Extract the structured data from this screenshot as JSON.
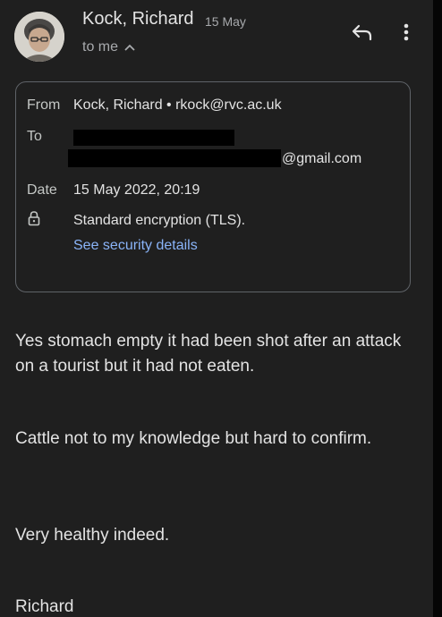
{
  "header": {
    "sender_name": "Kock, Richard",
    "date": "15 May",
    "recipient_summary": "to me"
  },
  "details": {
    "from_label": "From",
    "from_value": "Kock, Richard • rkock@rvc.ac.uk",
    "to_label": "To",
    "to_value_visible": "@gmail.com",
    "date_label": "Date",
    "date_value": "15 May 2022, 20:19",
    "encryption": "Standard encryption (TLS).",
    "security_link": "See security details"
  },
  "message": {
    "paragraphs": [
      "Yes stomach empty it had been shot after an attack on a tourist but it had not eaten.",
      "Cattle not to my knowledge but hard to confirm.",
      "Very healthy indeed."
    ],
    "signature": "Richard"
  },
  "icons": {
    "reply": "reply-icon",
    "more": "more-vert-icon",
    "chevron": "chevron-up-icon",
    "lock": "lock-icon"
  },
  "colors": {
    "background": "#1f1f1f",
    "link": "#8ab4f8",
    "text": "#e3e3e3",
    "muted": "#a8aaad"
  }
}
